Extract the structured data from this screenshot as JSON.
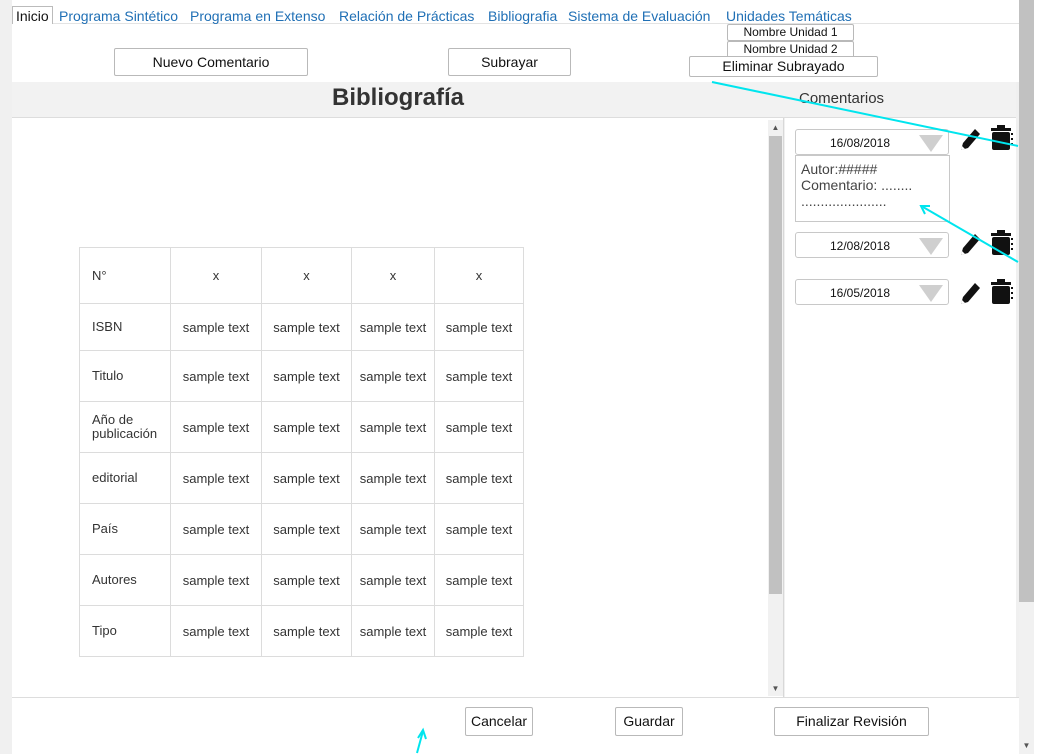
{
  "nav": {
    "items": [
      {
        "label": "Inicio",
        "active": true
      },
      {
        "label": "Programa Sintético"
      },
      {
        "label": "Programa en Extenso"
      },
      {
        "label": "Relación de Prácticas"
      },
      {
        "label": "Bibliografia"
      },
      {
        "label": "Sistema de Evaluación"
      },
      {
        "label": "Unidades Temáticas"
      }
    ],
    "units": [
      "Nombre Unidad 1",
      "Nombre Unidad 2"
    ]
  },
  "toolbar": {
    "new_comment": "Nuevo Comentario",
    "underline": "Subrayar",
    "remove_underline": "Eliminar Subrayado"
  },
  "page": {
    "title": "Bibliografía"
  },
  "table": {
    "header": [
      "N°",
      "x",
      "x",
      "x",
      "x"
    ],
    "rows": [
      {
        "label": "ISBN",
        "cells": [
          "sample text",
          "sample text",
          "sample text",
          "sample text"
        ]
      },
      {
        "label": "Titulo",
        "cells": [
          "sample text",
          "sample text",
          "sample text",
          "sample text"
        ]
      },
      {
        "label": "Año de publicación",
        "cells": [
          "sample text",
          "sample text",
          "sample text",
          "sample text"
        ]
      },
      {
        "label": "editorial",
        "cells": [
          "sample text",
          "sample text",
          "sample text",
          "sample text"
        ]
      },
      {
        "label": "País",
        "cells": [
          "sample text",
          "sample text",
          "sample text",
          "sample text"
        ]
      },
      {
        "label": "Autores",
        "cells": [
          "sample text",
          "sample text",
          "sample text",
          "sample text"
        ]
      },
      {
        "label": "Tipo",
        "cells": [
          "sample text",
          "sample text",
          "sample text",
          "sample text"
        ]
      }
    ]
  },
  "comments": {
    "title": "Comentarios",
    "entries": [
      {
        "date": "16/08/2018",
        "expanded": true,
        "author": "Autor:#####",
        "comment": "Comentario: ........",
        "continuation": "......................"
      },
      {
        "date": "12/08/2018"
      },
      {
        "date": "16/05/2018"
      }
    ]
  },
  "footer": {
    "cancel": "Cancelar",
    "save": "Guardar",
    "finish_review": "Finalizar Revisión"
  },
  "colors": {
    "link": "#1f6fb5",
    "annotation_arrow": "#00e5ee",
    "icon": "#111111"
  },
  "icons": [
    "pencil-icon",
    "trash-icon",
    "dropdown-arrow-icon",
    "scroll-up-arrow",
    "scroll-down-arrow"
  ]
}
